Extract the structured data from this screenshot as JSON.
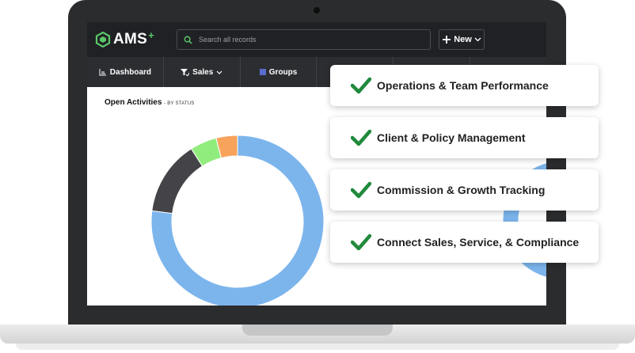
{
  "app": {
    "logo_text": "AMS",
    "logo_plus": "+"
  },
  "search": {
    "placeholder": "Search all records"
  },
  "header": {
    "new_label": "New"
  },
  "nav": {
    "items": [
      {
        "label": "Dashboard",
        "icon": "chart-icon"
      },
      {
        "label": "Sales",
        "icon": "funnel-icon"
      },
      {
        "label": "Groups",
        "icon": "square-icon"
      }
    ]
  },
  "panel": {
    "title": "Open Activities",
    "subtitle": "- BY STATUS"
  },
  "chart_data": {
    "type": "pie",
    "donut": true,
    "slices": [
      {
        "value": 77,
        "color": "#7cb5ec"
      },
      {
        "value": 14,
        "color": "#434348"
      },
      {
        "value": 5,
        "color": "#90ed7d"
      },
      {
        "value": 4,
        "color": "#f7a35c"
      }
    ]
  },
  "features": [
    {
      "label": "Operations & Team Performance"
    },
    {
      "label": "Client & Policy Management"
    },
    {
      "label": "Commission & Growth Tracking"
    },
    {
      "label": "Connect Sales, Service, & Compliance"
    }
  ],
  "colors": {
    "check": "#1f8a3b",
    "topbar": "#1f2124",
    "navbar": "#2b2d30",
    "brand_green": "#5cc66a"
  }
}
